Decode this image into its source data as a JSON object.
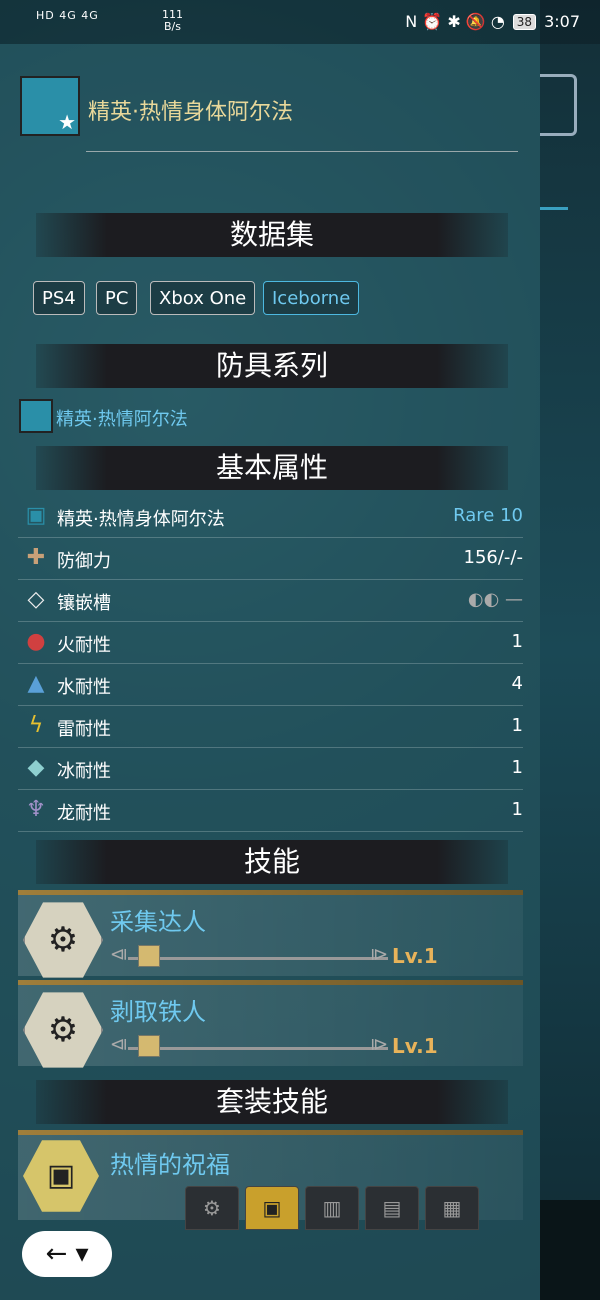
{
  "status_bar": {
    "left_indicators": "HD 4G 4G",
    "net_speed": "111",
    "net_unit": "B/s",
    "right_icons": "N ⏰ ✱ 🔕 ◔",
    "battery": "38",
    "time": "3:07"
  },
  "header": {
    "title": "精英·热情身体阿尔法",
    "icon": "armor-chest-icon"
  },
  "sections": {
    "dataset": "数据集",
    "armor_series": "防具系列",
    "basic_attributes": "基本属性",
    "skills": "技能",
    "set_skills": "套装技能"
  },
  "dataset_tags": [
    {
      "label": "PS4",
      "active": false
    },
    {
      "label": "PC",
      "active": false
    },
    {
      "label": "Xbox One",
      "active": false
    },
    {
      "label": "Iceborne",
      "active": true
    }
  ],
  "armor_series": {
    "name": "精英·热情阿尔法"
  },
  "attributes": [
    {
      "icon": "armor-chest-icon",
      "label": "精英·热情身体阿尔法",
      "value": "Rare 10"
    },
    {
      "icon": "defense-shield-icon",
      "label": "防御力",
      "value": "156/-/-"
    },
    {
      "icon": "gem-slot-icon",
      "label": "镶嵌槽",
      "value": "◐◐ —"
    },
    {
      "icon": "fire-icon",
      "label": "火耐性",
      "value": "1"
    },
    {
      "icon": "water-drop-icon",
      "label": "水耐性",
      "value": "4"
    },
    {
      "icon": "thunder-icon",
      "label": "雷耐性",
      "value": "1"
    },
    {
      "icon": "ice-icon",
      "label": "冰耐性",
      "value": "1"
    },
    {
      "icon": "dragon-icon",
      "label": "龙耐性",
      "value": "1"
    }
  ],
  "skills": [
    {
      "name": "采集达人",
      "level": "Lv.1",
      "level_fraction": 0.0
    },
    {
      "name": "剥取铁人",
      "level": "Lv.1",
      "level_fraction": 0.0
    }
  ],
  "set_skill": {
    "name": "热情的祝福"
  },
  "piece_tabs": [
    {
      "icon": "skill-tab-icon",
      "active": false
    },
    {
      "icon": "chest-tab-icon",
      "active": true
    },
    {
      "icon": "arms-tab-icon",
      "active": false
    },
    {
      "icon": "waist-tab-icon",
      "active": false
    },
    {
      "icon": "legs-tab-icon",
      "active": false
    }
  ],
  "back_button": {
    "label": "← ▾"
  }
}
